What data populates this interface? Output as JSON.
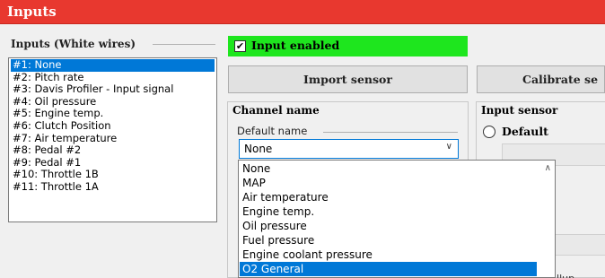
{
  "window": {
    "title": "Inputs"
  },
  "inputs_group": {
    "caption": "Inputs (White wires)",
    "items": [
      "#1: None",
      "#2: Pitch rate",
      "#3: Davis Profiler - Input signal",
      "#4: Oil pressure",
      "#5: Engine temp.",
      "#6: Clutch Position",
      "#7: Air temperature",
      "#8: Pedal #2",
      "#9: Pedal #1",
      "#10: Throttle 1B",
      "#11: Throttle 1A"
    ],
    "selected_index": 0
  },
  "input_enabled": {
    "label": "Input enabled",
    "checked": true,
    "check_glyph": "✔",
    "highlight_color": "#1ee61e"
  },
  "buttons": {
    "import_sensor": "Import sensor",
    "calibrate_sensor": "Calibrate se"
  },
  "channel_name": {
    "title": "Channel name",
    "default_name_caption": "Default name",
    "selected_value": "None"
  },
  "input_sensor": {
    "title": "Input sensor",
    "default_radio_label": "Default",
    "partial_text": "illup"
  },
  "dropdown": {
    "options": [
      "None",
      "MAP",
      "Air temperature",
      "Engine temp.",
      "Oil pressure",
      "Fuel pressure",
      "Engine coolant pressure",
      "O2 General"
    ],
    "highlighted_index": 7
  },
  "colors": {
    "titlebar": "#e8382f",
    "selection": "#0078d7"
  },
  "icons": {
    "select_arrow": "chevron-down-icon",
    "scroll_up": "chevron-up-icon"
  }
}
